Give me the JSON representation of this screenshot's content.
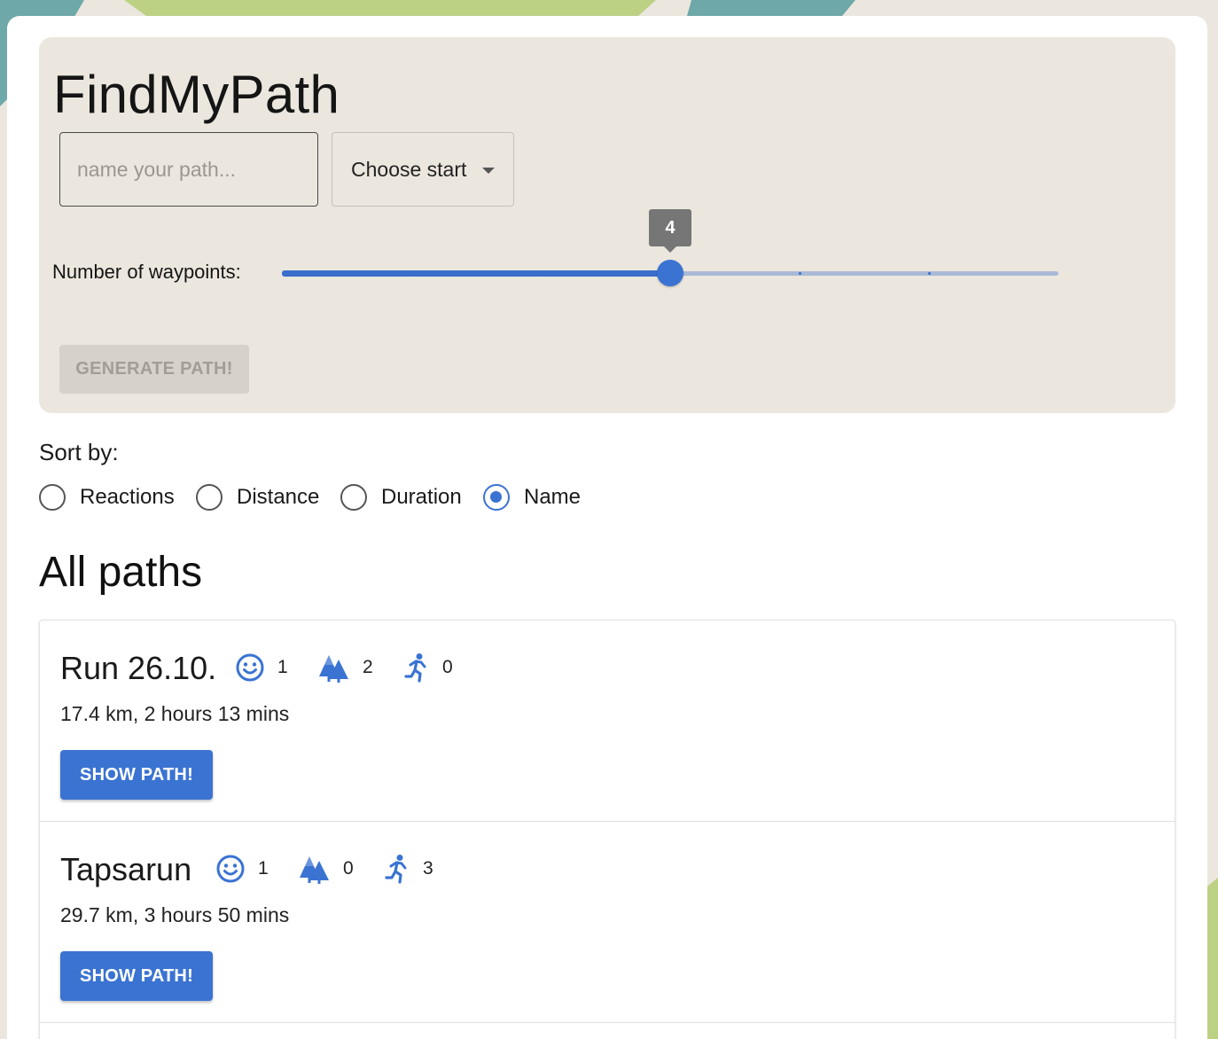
{
  "app": {
    "title": "FindMyPath"
  },
  "form": {
    "name_placeholder": "name your path...",
    "start_select": {
      "selected": "Choose start"
    },
    "waypoints": {
      "label": "Number of waypoints:",
      "value": 4,
      "min": 1,
      "max": 7,
      "display": "4"
    },
    "generate_label": "GENERATE PATH!"
  },
  "sort": {
    "label": "Sort by:",
    "options": [
      "Reactions",
      "Distance",
      "Duration",
      "Name"
    ],
    "selected": "Name"
  },
  "list": {
    "title": "All paths",
    "paths": [
      {
        "name": "Run 26.10.",
        "smile": "1",
        "trees": "2",
        "run": "0",
        "info": "17.4 km, 2 hours 13 mins",
        "button": "SHOW PATH!"
      },
      {
        "name": "Tapsarun",
        "smile": "1",
        "trees": "0",
        "run": "3",
        "info": "29.7 km, 3 hours 50 mins",
        "button": "SHOW PATH!"
      }
    ]
  },
  "icons": {
    "smile": "smiley-face-icon",
    "trees": "forest-trees-icon",
    "run": "running-person-icon"
  },
  "colors": {
    "accent": "#3a73d2",
    "panel": "#ebe7de",
    "disabled": "#d6d2ca"
  }
}
